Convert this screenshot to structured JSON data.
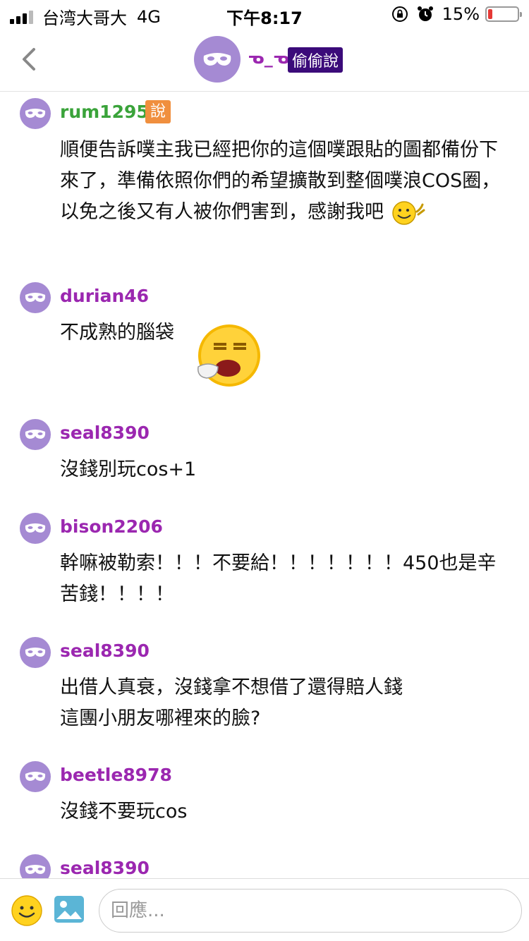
{
  "status_bar": {
    "carrier": "台湾大哥大",
    "network": "4G",
    "time": "下午8:17",
    "battery_percent": "15%",
    "battery_level": 0.15,
    "signal_bars": 3
  },
  "header": {
    "name": "ᓀ_ᓀ",
    "badge": "偷偷說",
    "back_icon": "chevron-left-icon",
    "avatar_icon": "mask-icon"
  },
  "colors": {
    "avatar": "#a58ad3",
    "username_purple": "#9b27b0",
    "username_green": "#3aa33a",
    "badge_dark": "#3b0b7a",
    "qual_badge": "#f08f3e"
  },
  "responses": [
    {
      "user": "rum1295",
      "qualifier": "說",
      "text": "順便告訴噗主我已經把你的這個噗跟貼的圖都備份下來了，準備依照你們的希望擴散到整個噗浪COS圈，以免之後又有人被你們害到，感謝我吧",
      "emoji": "smile-emoji"
    },
    {
      "user": "durian46",
      "text": "不成熟的腦袋",
      "emoji": "yawn-emoji"
    },
    {
      "user": "seal8390",
      "text": "沒錢別玩cos+1"
    },
    {
      "user": "bison2206",
      "text": "幹嘛被勒索！！！不要給！！！！！！！450也是辛苦錢！！！！"
    },
    {
      "user": "seal8390",
      "text": "出借人真衰，沒錢拿不想借了還得賠人錢\n這團小朋友哪裡來的臉?"
    },
    {
      "user": "beetle8978",
      "text": "沒錢不要玩cos"
    },
    {
      "user": "seal8390",
      "text": ""
    }
  ],
  "reply": {
    "placeholder": "回應..."
  }
}
